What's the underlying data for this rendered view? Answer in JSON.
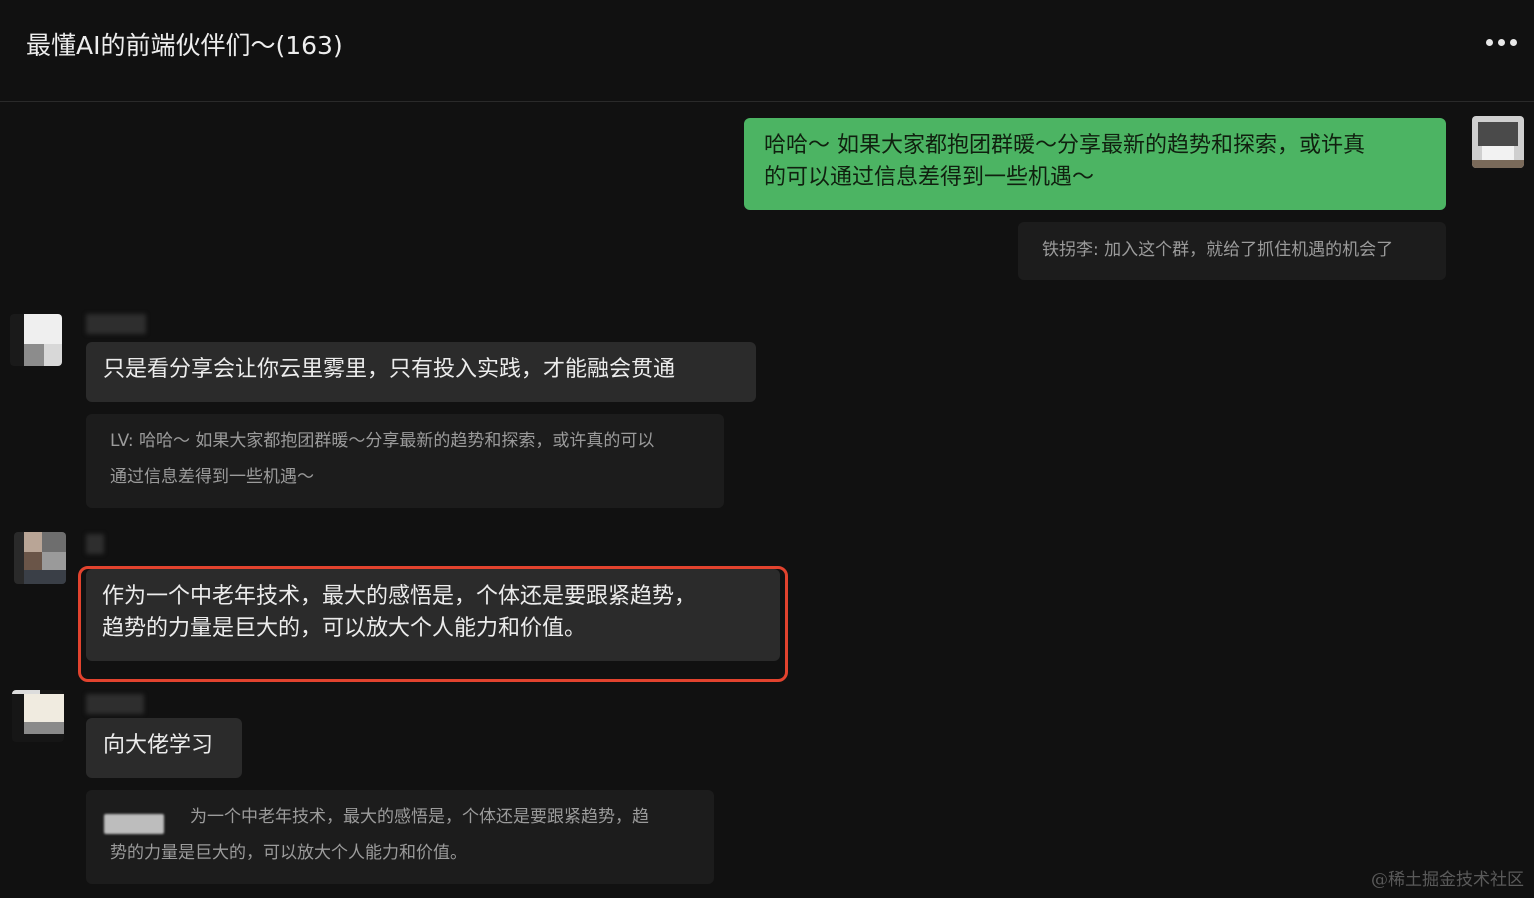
{
  "header": {
    "title": "最懂AI的前端伙伴们～(163)",
    "more_icon": "more-dots-icon"
  },
  "messages": {
    "outgoing": {
      "text_line1": "哈哈～ 如果大家都抱团群暖～分享最新的趋势和探索，或许真",
      "text_line2": "的可以通过信息差得到一些机遇～",
      "quote": "铁拐李: 加入这个群，就给了抓住机遇的机会了"
    },
    "msg1": {
      "text": "只是看分享会让你云里雾里，只有投入实践，才能融会贯通",
      "quote_line1": "LV: 哈哈～ 如果大家都抱团群暖～分享最新的趋势和探索，或许真的可以",
      "quote_line2": "通过信息差得到一些机遇～"
    },
    "msg2": {
      "text_line1": "作为一个中老年技术，最大的感悟是，个体还是要跟紧趋势，",
      "text_line2": "趋势的力量是巨大的，可以放大个人能力和价值。"
    },
    "msg3": {
      "text": "向大佬学习",
      "quote_line1": "为一个中老年技术，最大的感悟是，个体还是要跟紧趋势，趋",
      "quote_line2": "势的力量是巨大的，可以放大个人能力和价值。"
    }
  },
  "watermark": "@稀土掘金技术社区",
  "colors": {
    "background": "#111111",
    "outgoing_bubble": "#4cb463",
    "incoming_bubble": "#2b2b2b",
    "highlight": "#e2432e"
  }
}
